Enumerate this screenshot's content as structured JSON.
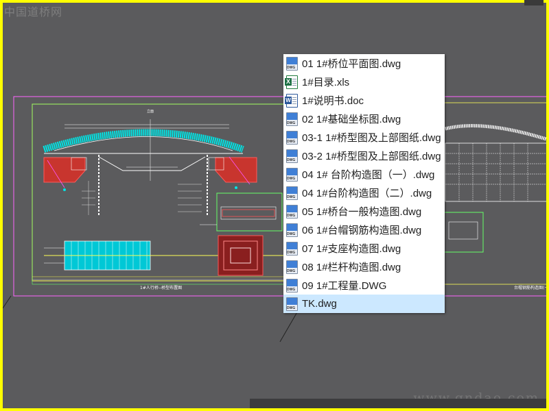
{
  "watermark": {
    "top": "中国道桥网",
    "bottom": "www.gndao.com"
  },
  "drawing": {
    "title_left": "1#人行桥--桥型布置图",
    "title_right": "台帽钢筋构造图(一)",
    "title_small_left": "立面"
  },
  "menu": {
    "items": [
      {
        "label": "01 1#桥位平面图.dwg",
        "icon": "dwg-file-icon",
        "selected": false
      },
      {
        "label": "1#目录.xls",
        "icon": "excel-file-icon",
        "selected": false
      },
      {
        "label": "1#说明书.doc",
        "icon": "word-file-icon",
        "selected": false
      },
      {
        "label": "02 1#基础坐标图.dwg",
        "icon": "dwg-file-icon",
        "selected": false
      },
      {
        "label": "03-1 1#桥型图及上部图纸.dwg",
        "icon": "dwg-file-icon",
        "selected": false
      },
      {
        "label": "03-2 1#桥型图及上部图纸.dwg",
        "icon": "dwg-file-icon",
        "selected": false
      },
      {
        "label": "04 1# 台阶构造图（一）.dwg",
        "icon": "dwg-file-icon",
        "selected": false
      },
      {
        "label": "04 1#台阶构造图（二）.dwg",
        "icon": "dwg-file-icon",
        "selected": false
      },
      {
        "label": "05 1#桥台一般构造图.dwg",
        "icon": "dwg-file-icon",
        "selected": false
      },
      {
        "label": "06 1#台帽钢筋构造图.dwg",
        "icon": "dwg-file-icon",
        "selected": false
      },
      {
        "label": "07 1#支座构造图.dwg",
        "icon": "dwg-file-icon",
        "selected": false
      },
      {
        "label": "08 1#栏杆构造图.dwg",
        "icon": "dwg-file-icon",
        "selected": false
      },
      {
        "label": "09 1#工程量.DWG",
        "icon": "dwg-file-icon",
        "selected": false
      },
      {
        "label": "TK.dwg",
        "icon": "dwg-file-icon",
        "selected": true
      }
    ]
  },
  "colors": {
    "frame": "#ffff00",
    "background": "#5b5b5d",
    "selection": "#cce8ff"
  }
}
